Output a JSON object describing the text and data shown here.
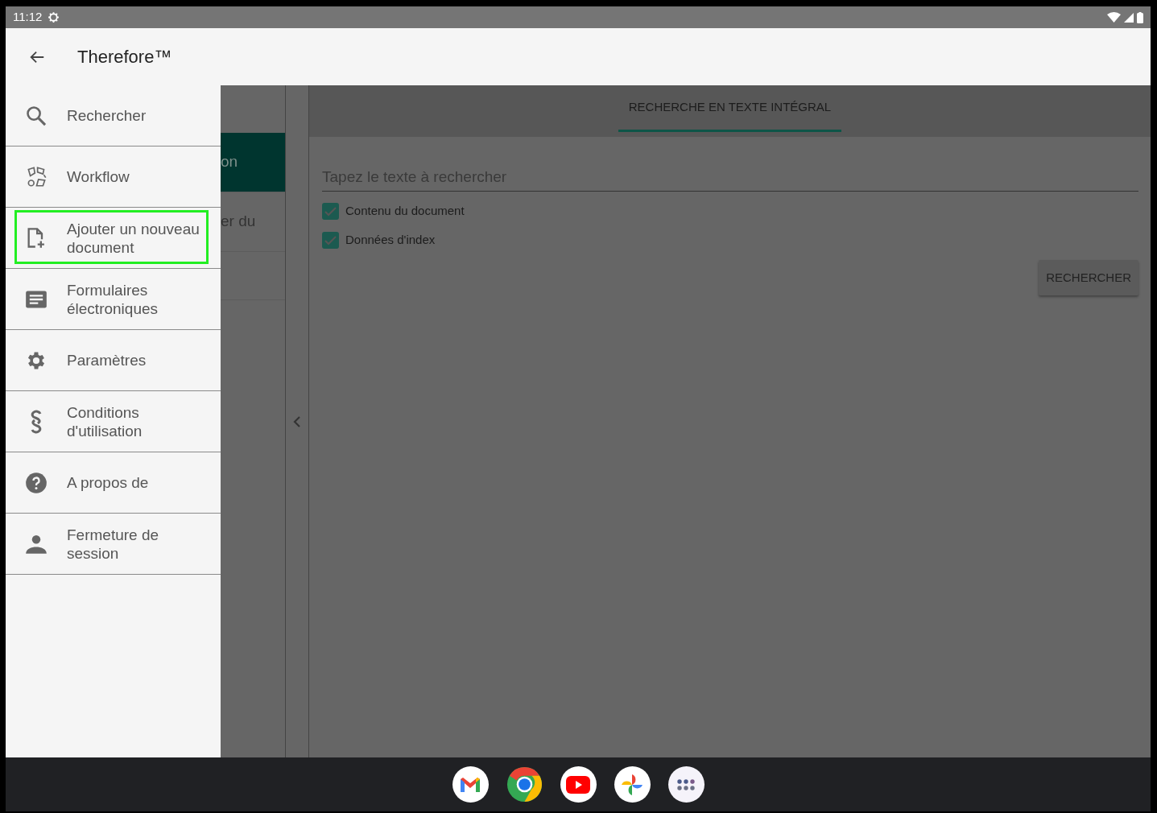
{
  "status_bar": {
    "time": "11:12"
  },
  "app_bar": {
    "title": "Therefore™"
  },
  "drawer": {
    "items": [
      {
        "label": "Rechercher",
        "highlighted": false
      },
      {
        "label": "Workflow",
        "highlighted": false
      },
      {
        "label": "Ajouter un nouveau document",
        "highlighted": true
      },
      {
        "label": "Formulaires électroniques",
        "highlighted": false
      },
      {
        "label": "Paramètres",
        "highlighted": false
      },
      {
        "label": "Conditions d'utilisation",
        "highlighted": false
      },
      {
        "label": "A propos de",
        "highlighted": false
      },
      {
        "label": "Fermeture de session",
        "highlighted": false
      }
    ]
  },
  "list_panel": {
    "items": [
      {
        "text": "on",
        "selected": true
      },
      {
        "text": "er du",
        "selected": false
      }
    ]
  },
  "search_panel": {
    "tabs": [
      {
        "label": "RECHERCHE EN TEXTE INTÉGRAL",
        "selected": true
      }
    ],
    "field": {
      "placeholder": "Tapez le texte à rechercher"
    },
    "options": [
      {
        "label": "Contenu du document",
        "checked": true
      },
      {
        "label": "Données d'index",
        "checked": true
      }
    ],
    "button": "RECHERCHER"
  }
}
